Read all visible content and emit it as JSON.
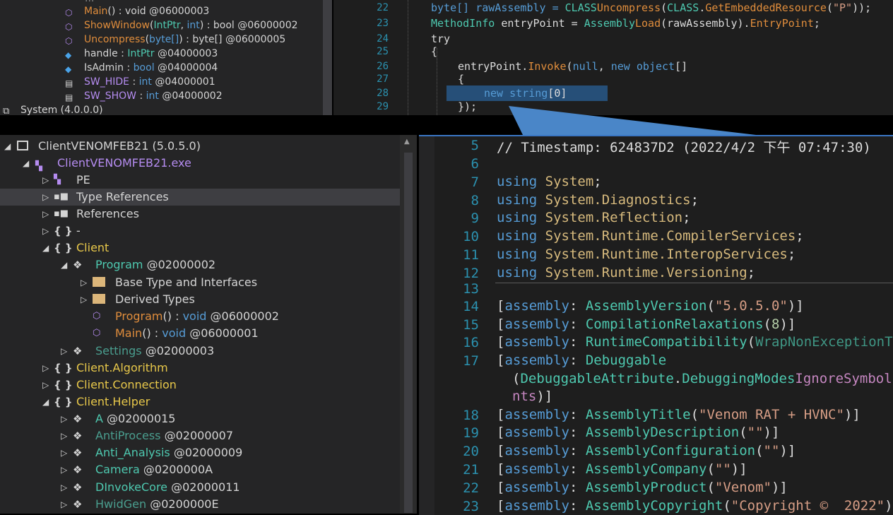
{
  "top_left_tree": {
    "partial_row": "...",
    "items": [
      {
        "name": "Main",
        "sig": "() : void",
        "token": "@06000003"
      },
      {
        "name": "ShowWindow",
        "sig_open": "(",
        "p1": "IntPtr",
        "p2": "int",
        "sig_close": ") : bool",
        "token": "@06000002"
      },
      {
        "name": "Uncompress",
        "sig_open": "(",
        "p1": "byte[]",
        "sig_close": ") : byte[]",
        "token": "@06000005"
      },
      {
        "name": "handle",
        "sig": " : ",
        "type": "IntPtr",
        "token": "@04000003"
      },
      {
        "name": "IsAdmin",
        "sig": " : ",
        "type": "bool",
        "token": "@04000004"
      },
      {
        "name": "SW_HIDE",
        "sig": " : ",
        "type": "int",
        "token": "@04000001"
      },
      {
        "name": "SW_SHOW",
        "sig": " : ",
        "type": "int",
        "token": "@04000002"
      }
    ],
    "assembly": "System (4.0.0.0)"
  },
  "top_code": {
    "lines": [
      {
        "n": "22"
      },
      {
        "n": "23"
      },
      {
        "n": "24"
      },
      {
        "n": "25"
      },
      {
        "n": "26"
      },
      {
        "n": "27"
      },
      {
        "n": "28"
      },
      {
        "n": "29"
      }
    ],
    "l22": {
      "a": "byte[] rawAssembly = ",
      "b": "CLASS",
      ".": ".",
      "c": "Uncompress",
      "d": "(",
      "e": "CLASS",
      "f": ".",
      "g": "GetEmbeddedResource",
      "h": "(",
      "s": "\"P\"",
      "i": "));"
    },
    "l23": {
      "a": "MethodInfo",
      "b": " entryPoint = ",
      "c": "Assembly",
      ".": ".",
      "d": "Load",
      "e": "(rawAssembly).",
      "f": "EntryPoint",
      ";": ";"
    },
    "l24": "try",
    "l25": "{",
    "l26": {
      "a": "entryPoint.",
      "b": "Invoke",
      "c": "(",
      "d": "null",
      ",": ", ",
      "e": "new",
      "f": " object",
      "g": "[]"
    },
    "l27": "{",
    "l28": {
      "a": "new",
      "b": " string",
      "c": "[0]"
    },
    "l29": "});"
  },
  "bottom_tree": {
    "root": {
      "label": "ClientVENOMFEB21",
      "version": "(5.0.5.0)"
    },
    "exe": "ClientVENOMFEB21.exe",
    "pe": "PE",
    "type_refs": "Type References",
    "refs": "References",
    "dash_ns": "-",
    "client_ns": "Client",
    "program": {
      "name": "Program",
      "token": "@02000002"
    },
    "base_types": "Base Type and Interfaces",
    "derived": "Derived Types",
    "program_ctor": {
      "name": "Program",
      "sig": "() : ",
      "type": "void",
      "token": "@06000002"
    },
    "main": {
      "name": "Main",
      "sig": "() : ",
      "type": "void",
      "token": "@06000001"
    },
    "settings": {
      "name": "Settings",
      "token": "@02000003"
    },
    "ns_algorithm": "Client.Algorithm",
    "ns_connection": "Client.Connection",
    "ns_helper": "Client.Helper",
    "classes": [
      {
        "name": "A",
        "token": "@02000015"
      },
      {
        "name": "AntiProcess",
        "token": "@02000007"
      },
      {
        "name": "Anti_Analysis",
        "token": "@02000009"
      },
      {
        "name": "Camera",
        "token": "@0200000A"
      },
      {
        "name": "DInvokeCore",
        "token": "@02000011"
      },
      {
        "name": "HwidGen",
        "token": "@0200000E"
      }
    ]
  },
  "bottom_code": {
    "l5": {
      "n": "5",
      "t": "// Timestamp: 624837D2 (2022/4/2 下午 07:47:30)"
    },
    "l6": {
      "n": "6"
    },
    "usings": [
      {
        "n": "7",
        "ns": "System"
      },
      {
        "n": "8",
        "ns": "System.Diagnostics"
      },
      {
        "n": "9",
        "ns": "System.Reflection"
      },
      {
        "n": "10",
        "ns": "System.Runtime.CompilerServices"
      },
      {
        "n": "11",
        "ns": "System.Runtime.InteropServices"
      },
      {
        "n": "12",
        "ns": "System.Runtime.Versioning"
      }
    ],
    "using_kw": "using",
    "l13": {
      "n": "13"
    },
    "attrs": [
      {
        "n": "14",
        "attr": "AssemblyVersion",
        "open": "(",
        "val": "\"5.0.5.0\"",
        "close": ")]"
      },
      {
        "n": "15",
        "attr": "CompilationRelaxations",
        "open": "(",
        "val": "8",
        "close": ")]"
      },
      {
        "n": "16",
        "attr": "RuntimeCompatibility",
        "open": "(",
        "val": "WrapNonExceptionTh",
        "close": ""
      },
      {
        "n": "17",
        "attr": "Debuggable",
        "open": "",
        "val": "",
        "close": ""
      }
    ],
    "asm_kw": "assembly",
    "l17b": {
      "a": "(",
      "b": "DebuggableAttribute",
      "c": ".",
      "d": "DebuggingModes",
      ".": ".",
      "e": "IgnoreSymbol"
    },
    "l17c": {
      "a": "nts",
      "b": ")]"
    },
    "attrs2": [
      {
        "n": "18",
        "attr": "AssemblyTitle",
        "val": "\"Venom RAT + HVNC\""
      },
      {
        "n": "19",
        "attr": "AssemblyDescription",
        "val": "\"\""
      },
      {
        "n": "20",
        "attr": "AssemblyConfiguration",
        "val": "\"\""
      },
      {
        "n": "21",
        "attr": "AssemblyCompany",
        "val": "\"\""
      },
      {
        "n": "22",
        "attr": "AssemblyProduct",
        "val": "\"Venom\""
      },
      {
        "n": "23",
        "attr": "AssemblyCopyright",
        "val": "\"Copyright ©  2022\"",
        "close": ")]"
      }
    ]
  }
}
